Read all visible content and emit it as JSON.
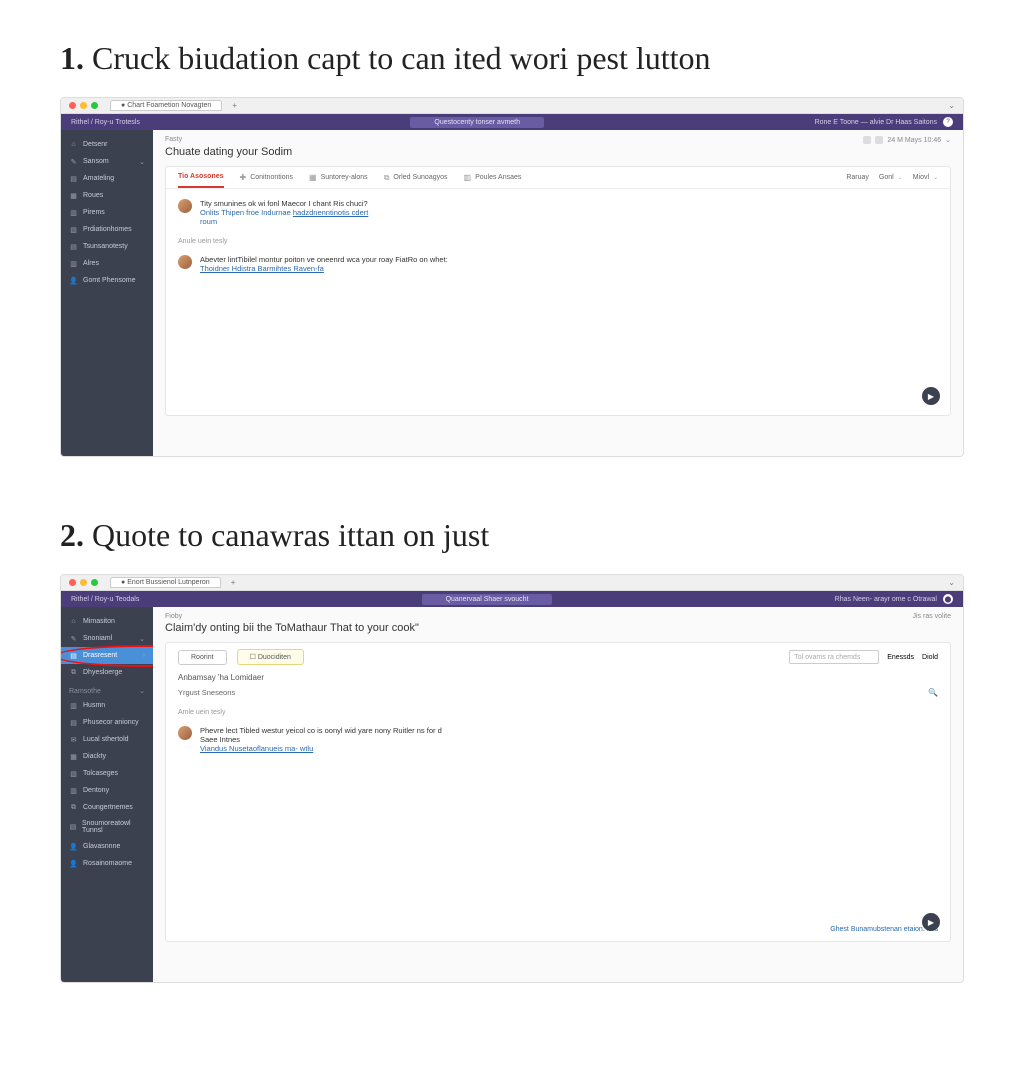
{
  "step1": {
    "num": "1.",
    "title": "Cruck biudation capt to can ited wori pest lutton",
    "tab_title": "Chart Foametion Novagten",
    "brand_left": "Rithel / Roy-u Trotesls",
    "brand_center": "Questocenty tonser avmeth",
    "brand_right": "Rone E Toone — alvie Dr Haas Saitons",
    "sidebar": [
      {
        "icon": "⌂",
        "label": "Detsenr"
      },
      {
        "icon": "✎",
        "label": "Sansom",
        "chev": "⌄"
      },
      {
        "icon": "▤",
        "label": "Amateling"
      },
      {
        "icon": "▦",
        "label": "Roues"
      },
      {
        "icon": "▥",
        "label": "Pirems"
      },
      {
        "icon": "▧",
        "label": "Prdiationhomes"
      },
      {
        "icon": "▤",
        "label": "Tsunsanotesty"
      },
      {
        "icon": "▥",
        "label": "Alres"
      },
      {
        "icon": "👤",
        "label": "Gomt Phensome"
      }
    ],
    "crumb": "Fasty",
    "crumb_right": "24 M Mays 10:46",
    "heading": "Chuate dating your Sodim",
    "tabs": [
      {
        "label": "Tio Asosones",
        "active": true
      },
      {
        "icon": "✚",
        "label": "Conitnontions"
      },
      {
        "icon": "▦",
        "label": "Suntorey-alons"
      },
      {
        "icon": "⧉",
        "label": "Orled Sunoagyos"
      },
      {
        "icon": "▥",
        "label": "Poules Ansaes"
      }
    ],
    "rightbtns": [
      "Raruay",
      "Gonl ⌄",
      "Miovl ⌄"
    ],
    "post1": {
      "l1": "Tity smunines ok wi fonl Maecor I chant Ris chuci?",
      "l2a": "Onlits Thipen froe Indurnae",
      "l2b": "hadzdnenntinotis cdert",
      "l3": "roum"
    },
    "divider": "Anule uein tesly",
    "post2": {
      "l1": "Abevter lintTibilel montur poiton ve oneenrd wca your roay FiatRo on whet:",
      "l2a": "Thoidner Hdistra Barmihtes Raven-fa"
    }
  },
  "step2": {
    "num": "2.",
    "title": "Quote to canawras ittan on just",
    "tab_title": "Enort Bussienol Lutnperon",
    "brand_left": "Rithel / Roy-u Teodals",
    "brand_center": "Quanervaal Shaer svoucht",
    "brand_right": "Rhas Neen- arayr ome c Otrawal",
    "crumb": "Fioby",
    "crumb_right": "Jis ras volite",
    "heading": "Claim'dy onting bii the ToMathaur That to your cook\"",
    "sidebar_top": [
      {
        "icon": "⌂",
        "label": "Mimasiton"
      },
      {
        "icon": "✎",
        "label": "Snoniaml",
        "chev": "⌄"
      },
      {
        "icon": "▤",
        "label": "Drasresent",
        "active": true,
        "chev": "›"
      },
      {
        "icon": "⧉",
        "label": "Dhyesloerge"
      }
    ],
    "sidebar_head": "Ramsothe",
    "sidebar_bottom": [
      {
        "icon": "▥",
        "label": "Husmn"
      },
      {
        "icon": "▤",
        "label": "Phusecor anioncy"
      },
      {
        "icon": "✉",
        "label": "Lucal sthertold"
      },
      {
        "icon": "▦",
        "label": "Diackty"
      },
      {
        "icon": "▧",
        "label": "Tolcaseges"
      },
      {
        "icon": "▥",
        "label": "Dentony"
      },
      {
        "icon": "⧉",
        "label": "Coungertnemes"
      },
      {
        "icon": "▤",
        "label": "Snoumoreatowl Tunnsl"
      },
      {
        "icon": "👤",
        "label": "Glavasnnne"
      },
      {
        "icon": "👤",
        "label": "Rosainomaome"
      }
    ],
    "tabs2": {
      "btn1": "Roorint",
      "btn2_icon": "☐",
      "btn2": "Duociditen",
      "search_ph": "Tol ovams ra chemds",
      "a1": "Enessds",
      "a2": "Diold"
    },
    "subhead": "Anbamsay 'ha Lomidaer",
    "subrow": "Yrgust Sneseons",
    "divider": "Amle uein tesly",
    "post": {
      "l1": "Phevre lect Tibled westur yeicol co is oonyl wid yare nony Ruitler ns for d",
      "l2": "Saee  Intnes",
      "l3a": "Viandus  Nusetaoflanueis ma- wtlu"
    },
    "footerlink": "Ghest Bunamubstenan etaion. lors"
  }
}
